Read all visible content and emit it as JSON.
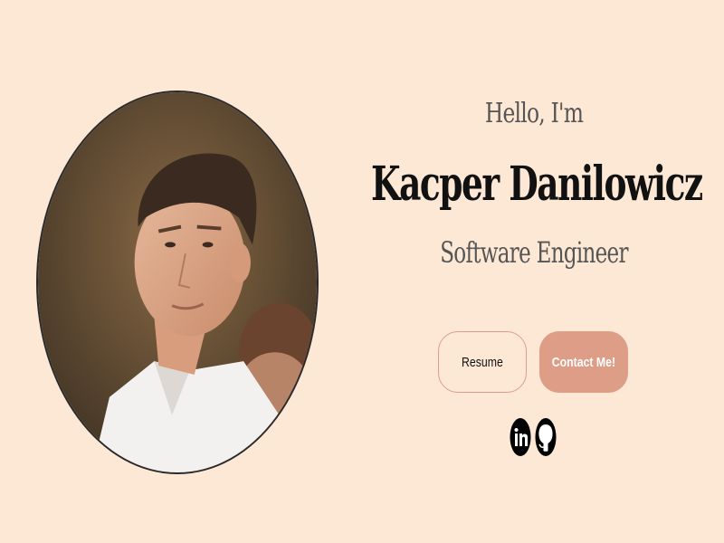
{
  "hero": {
    "greeting": "Hello, I'm",
    "name": "Kacper Danilowicz",
    "role": "Software Engineer"
  },
  "buttons": {
    "resume_label": "Resume",
    "contact_label": "Contact Me!"
  },
  "socials": {
    "items": [
      {
        "icon": "linkedin-icon"
      },
      {
        "icon": "github-icon"
      }
    ]
  },
  "colors": {
    "background": "#fde8d6",
    "accent": "#dd9d86",
    "border_accent": "#d8a08c"
  }
}
